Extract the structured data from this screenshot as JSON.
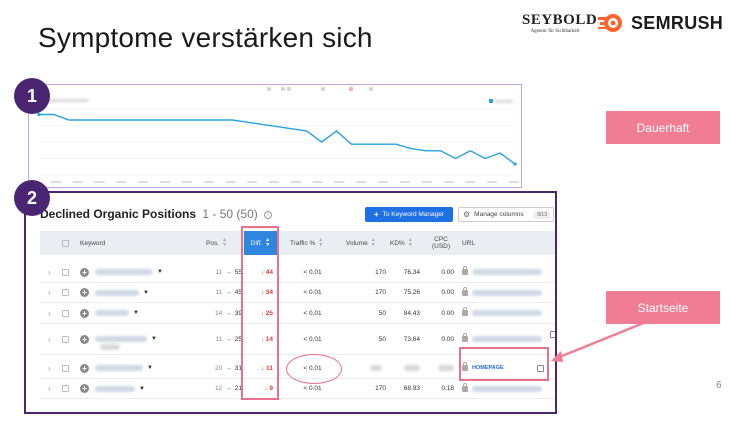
{
  "slide": {
    "title": "Symptome verstärken sich",
    "page_number": "6"
  },
  "logos": {
    "seybold_name": "SEYBOLD",
    "seybold_tagline": "Agentur für Sichtbarkeit",
    "semrush_name": "SEMRUSH",
    "semrush_color": "#ff642d"
  },
  "badges": [
    "1",
    "2"
  ],
  "callouts": {
    "dauerhaft": "Dauerhaft",
    "startseite": "Startseite"
  },
  "table": {
    "title": "Declined Organic Positions",
    "range": "1 - 50 (50)",
    "kwm_button": "To Keyword Manager",
    "manage_columns": "Manage columns",
    "columns_count": "9/13",
    "headers": {
      "keyword": "Keyword",
      "pos": "Pos.",
      "diff": "Diff.",
      "traffic": "Traffic %",
      "volume": "Volume",
      "kd": "KD%",
      "cpc_line1": "CPC",
      "cpc_line2": "(USD)",
      "url": "URL"
    },
    "rows": [
      {
        "pos_from": "11",
        "pos_to": "55",
        "diff": "↓ 44",
        "traffic": "< 0.01",
        "volume": "170",
        "kd": "76.34",
        "cpc": "0.00"
      },
      {
        "pos_from": "11",
        "pos_to": "45",
        "diff": "↓ 34",
        "traffic": "< 0.01",
        "volume": "170",
        "kd": "75.26",
        "cpc": "0.00"
      },
      {
        "pos_from": "14",
        "pos_to": "39",
        "diff": "↓ 25",
        "traffic": "< 0.01",
        "volume": "50",
        "kd": "84.43",
        "cpc": "0.00"
      },
      {
        "pos_from": "11",
        "pos_to": "25",
        "diff": "↓ 14",
        "traffic": "< 0.01",
        "volume": "50",
        "kd": "73.64",
        "cpc": "0.00"
      },
      {
        "pos_from": "20",
        "pos_to": "31",
        "diff": "↓ 11",
        "traffic": "< 0.01",
        "volume": "",
        "kd": "",
        "cpc": "",
        "url_label": "HOMEPAGE"
      },
      {
        "pos_from": "12",
        "pos_to": "21",
        "diff": "↓ 9",
        "traffic": "< 0.01",
        "volume": "170",
        "kd": "68.93",
        "cpc": "0.18"
      }
    ]
  },
  "colors": {
    "badge": "#4a2672",
    "callout": "#f07d93",
    "diff_header": "#2e86de",
    "decline": "#d93c3c",
    "line": "#2aa1e0"
  },
  "chart_data": {
    "type": "line",
    "series": [
      {
        "values": [
          95,
          95,
          90,
          90,
          90,
          90,
          90,
          90,
          90,
          90,
          90,
          90,
          90,
          90,
          88,
          86,
          84,
          82,
          80,
          70,
          80,
          68,
          68,
          68,
          68,
          64,
          62,
          62,
          55,
          62,
          55,
          60,
          50
        ]
      }
    ],
    "ylim": [
      40,
      100
    ],
    "grid": true
  }
}
